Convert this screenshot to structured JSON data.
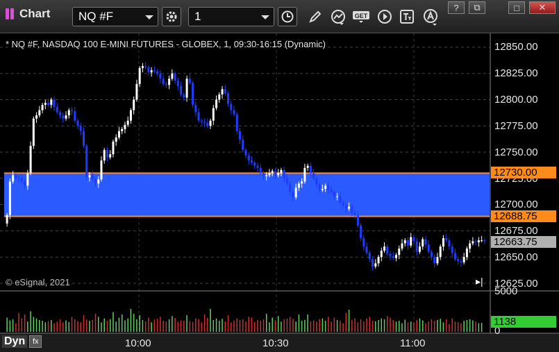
{
  "toolbar": {
    "app_label": "Chart",
    "symbol_value": "NQ #F",
    "interval_value": "1",
    "window_controls": {
      "help": "?",
      "restore": "⧉",
      "maximize": "□",
      "close": "✕"
    },
    "icons": [
      "gear-icon",
      "clock-icon",
      "pencil-icon",
      "study-icon",
      "get-icon",
      "play-icon",
      "text-tool-icon",
      "alert-icon"
    ]
  },
  "chart": {
    "info": "* NQ #F, NASDAQ 100 E-MINI FUTURES - GLOBEX, 1, 09:30-16:15 (Dynamic)",
    "copyright": "© eSignal, 2021",
    "bottom_tab": "Dyn",
    "bottom_tab_icon": "fx",
    "price_axis": [
      "12850.00",
      "12825.00",
      "12800.00",
      "12775.00",
      "12750.00",
      "12725.00",
      "12700.00",
      "12675.00",
      "12650.00",
      "12625.00"
    ],
    "time_axis": [
      "10:00",
      "10:30",
      "11:00"
    ],
    "volume_axis": [
      "5000",
      "0"
    ],
    "tags": {
      "upper_line": "12730.00",
      "lower_line": "12688.75",
      "last_price": "12663.75",
      "volume": "1138"
    },
    "colors": {
      "zone_fill": "#2b5bff",
      "zone_lines": "#ff8c1a",
      "up_candle": "#ffffff",
      "down_candle": "#1e3cff",
      "volume_up": "#5fd35f",
      "volume_down": "#d23030",
      "volume_tag": "#33cc33"
    }
  },
  "chart_data": {
    "type": "candlestick",
    "y_range": [
      12625,
      12850
    ],
    "zone": {
      "upper": 12730.0,
      "lower": 12688.75
    },
    "last_price": 12663.75,
    "closes": [
      12690,
      12722,
      12728,
      12726,
      12725,
      12722,
      12718,
      12730,
      12756,
      12782,
      12785,
      12790,
      12795,
      12797,
      12795,
      12800,
      12793,
      12788,
      12785,
      12782,
      12785,
      12790,
      12789,
      12780,
      12775,
      12770,
      12756,
      12726,
      12728,
      12724,
      12720,
      12724,
      12742,
      12752,
      12745,
      12748,
      12760,
      12764,
      12770,
      12772,
      12776,
      12780,
      12790,
      12800,
      12815,
      12830,
      12832,
      12831,
      12826,
      12828,
      12827,
      12825,
      12820,
      12815,
      12814,
      12820,
      12825,
      12818,
      12813,
      12805,
      12802,
      12820,
      12816,
      12795,
      12788,
      12780,
      12779,
      12778,
      12775,
      12780,
      12792,
      12800,
      12805,
      12810,
      12806,
      12796,
      12790,
      12786,
      12770,
      12762,
      12752,
      12747,
      12742,
      12740,
      12737,
      12735,
      12730,
      12727,
      12728,
      12730,
      12732,
      12728,
      12730,
      12733,
      12725,
      12720,
      12712,
      12707,
      12716,
      12720,
      12722,
      12735,
      12737,
      12730,
      12725,
      12719,
      12714,
      12715,
      12718,
      12714,
      12712,
      12708,
      12708,
      12702,
      12699,
      12696,
      12698,
      12692,
      12690,
      12680,
      12668,
      12660,
      12654,
      12648,
      12641,
      12644,
      12650,
      12656,
      12660,
      12653,
      12651,
      12649,
      12652,
      12658,
      12663,
      12666,
      12661,
      12669,
      12665,
      12655,
      12660,
      12667,
      12662,
      12655,
      12650,
      12644,
      12650,
      12660,
      12668,
      12666,
      12660,
      12654,
      12648,
      12646,
      12645,
      12650,
      12658,
      12663,
      12665,
      12664,
      12666,
      12666,
      12665
    ],
    "volume": [
      1800,
      1450,
      1600,
      1100,
      2400,
      1700,
      2200,
      1300,
      2600,
      1900,
      1700,
      1500,
      1400,
      1200,
      1350,
      1500,
      1100,
      1300,
      1600,
      1200,
      1450,
      1250,
      1900,
      1600,
      1350,
      1200,
      2100,
      1550,
      1400,
      1500,
      2300,
      1900,
      1200,
      1700,
      1400,
      1600,
      2500,
      1300,
      1800,
      2200,
      1450,
      1700,
      2900,
      2300,
      1600,
      2100,
      1500,
      1300,
      1800,
      1200,
      1550,
      1650,
      1900,
      1400,
      1300,
      1600,
      2000,
      1750,
      1300,
      1450,
      1400,
      2100,
      1350,
      1250,
      1700,
      1600,
      1200,
      2200,
      1800,
      2900,
      1500,
      1700,
      1400,
      1650,
      1300,
      2100,
      1200,
      1400,
      1700,
      1500,
      1600,
      1300,
      1900,
      1800,
      1250,
      1500,
      1400,
      1600,
      2300,
      1200,
      1800,
      1450,
      2000,
      1300,
      1600,
      1700,
      1900,
      1650,
      1300,
      2200,
      1400,
      1500,
      2200,
      1350,
      1450,
      1300,
      1600,
      1700,
      1400,
      1900,
      1300,
      1800,
      1500,
      1400,
      1100,
      2400,
      2800,
      1500,
      1700,
      1200,
      1600,
      1300,
      1700,
      1900,
      1400,
      1350,
      1500,
      1700,
      1600,
      2000,
      1800,
      1500,
      1300,
      1400,
      1100,
      1550,
      1200,
      1300,
      1200,
      1500,
      1700,
      1450,
      1100,
      1300,
      1600,
      1400,
      1500,
      1650,
      1200,
      1600,
      1000,
      1700,
      1300,
      1250,
      1100,
      1400,
      1500,
      1600,
      1450,
      1300,
      1100,
      1138
    ]
  }
}
